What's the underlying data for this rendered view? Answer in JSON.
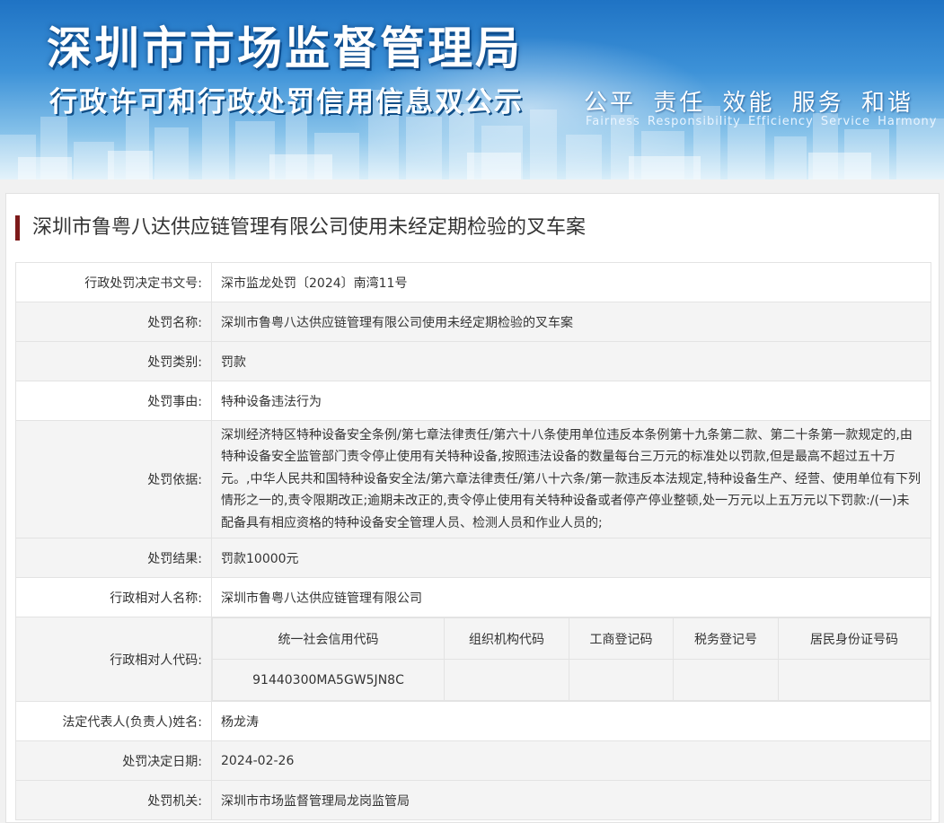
{
  "banner": {
    "title": "深圳市市场监督管理局",
    "subtitle": "行政许可和行政处罚信用信息双公示",
    "values_cn": "公平 责任 效能 服务 和谐",
    "values_en": "Fairness Responsibility Efficiency Service Harmony"
  },
  "case": {
    "title": "深圳市鲁粤八达供应链管理有限公司使用未经定期检验的叉车案"
  },
  "rows": {
    "doc_no": {
      "label": "行政处罚决定书文号:",
      "value": "深市监龙处罚〔2024〕南湾11号"
    },
    "name": {
      "label": "处罚名称:",
      "value": "深圳市鲁粤八达供应链管理有限公司使用未经定期检验的叉车案"
    },
    "type": {
      "label": "处罚类别:",
      "value": "罚款"
    },
    "reason": {
      "label": "处罚事由:",
      "value": "特种设备违法行为"
    },
    "basis": {
      "label": "处罚依据:",
      "value": "深圳经济特区特种设备安全条例/第七章法律责任/第六十八条使用单位违反本条例第十九条第二款、第二十条第一款规定的,由特种设备安全监管部门责令停止使用有关特种设备,按照违法设备的数量每台三万元的标准处以罚款,但是最高不超过五十万元。,中华人民共和国特种设备安全法/第六章法律责任/第八十六条/第一款违反本法规定,特种设备生产、经营、使用单位有下列情形之一的,责令限期改正;逾期未改正的,责令停止使用有关特种设备或者停产停业整顿,处一万元以上五万元以下罚款:/(一)未配备具有相应资格的特种设备安全管理人员、检测人员和作业人员的;"
    },
    "result": {
      "label": "处罚结果:",
      "value": "罚款10000元"
    },
    "party": {
      "label": "行政相对人名称:",
      "value": "深圳市鲁粤八达供应链管理有限公司"
    },
    "codes": {
      "label": "行政相对人代码:",
      "headers": [
        "统一社会信用代码",
        "组织机构代码",
        "工商登记码",
        "税务登记号",
        "居民身份证号码"
      ],
      "values": [
        "91440300MA5GW5JN8C",
        "",
        "",
        "",
        ""
      ]
    },
    "legal_rep": {
      "label": "法定代表人(负责人)姓名:",
      "value": "杨龙涛"
    },
    "date": {
      "label": "处罚决定日期:",
      "value": "2024-02-26"
    },
    "agency": {
      "label": "处罚机关:",
      "value": "深圳市市场监督管理局龙岗监管局"
    }
  }
}
